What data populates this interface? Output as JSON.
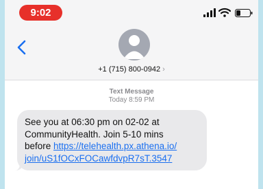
{
  "status_bar": {
    "time": "9:02"
  },
  "contact": {
    "phone": "+1 (715) 800-0942",
    "chevron": "›"
  },
  "thread_meta": {
    "type": "Text Message",
    "timestamp": "Today 8:59 PM"
  },
  "message": {
    "lines": [
      "See you at 06:30 pm on 02-02 at",
      "CommunityHealth. Join 5-10 mins",
      "before "
    ],
    "link_part1": "https://telehealth.px.athena.io/",
    "link_part2": "join/uS1fOCxFOCawfdvpR7sT.3547"
  },
  "icons": {
    "back": "chevron-left-icon",
    "avatar": "person-avatar-icon",
    "signal": "cellular-signal-icon",
    "wifi": "wifi-icon",
    "battery": "battery-icon"
  },
  "colors": {
    "accent": "#1a6ff0",
    "time_pill": "#e7302a",
    "bubble": "#e9e9eb"
  }
}
